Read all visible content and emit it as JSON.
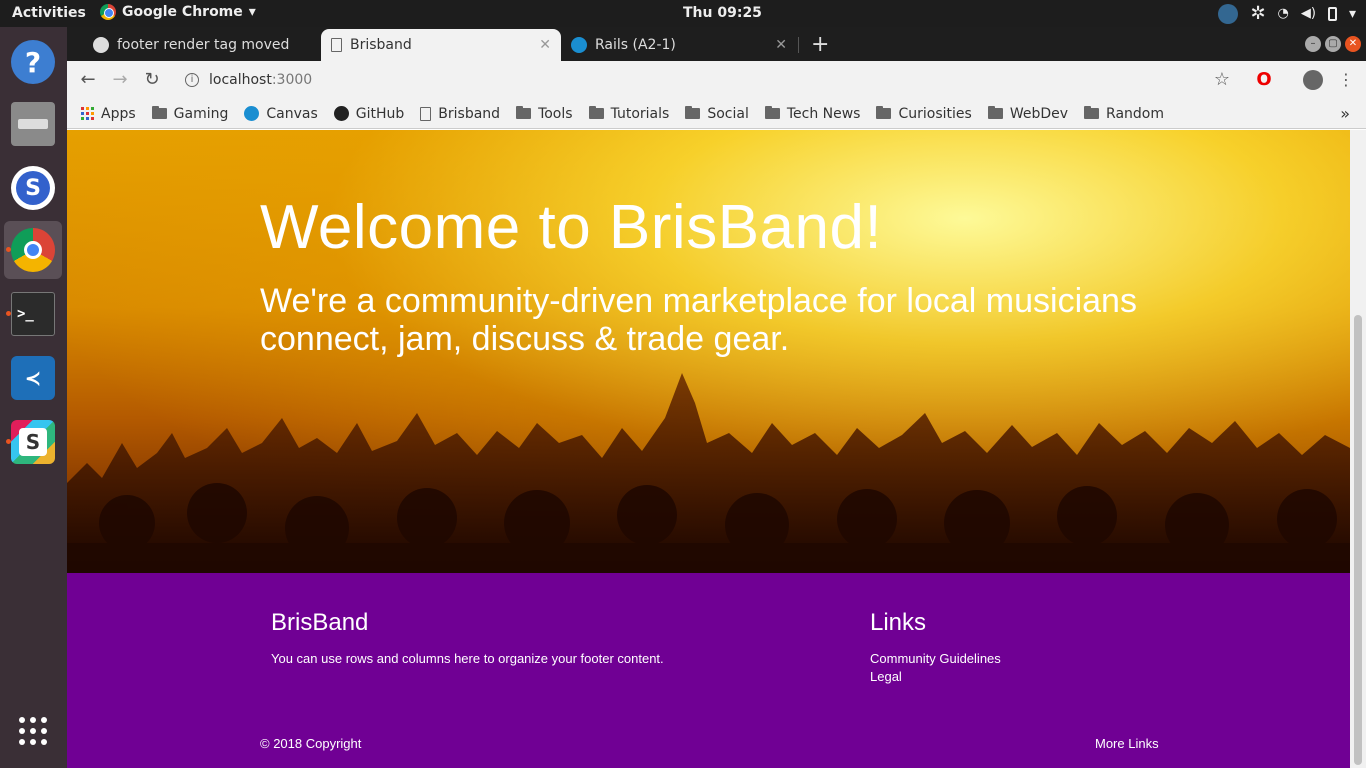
{
  "system": {
    "activities": "Activities",
    "app_name": "Google Chrome",
    "clock": "Thu 09:25"
  },
  "browser": {
    "tabs": [
      {
        "title": "footer render tag moved",
        "icon": "github-icon"
      },
      {
        "title": "Brisband",
        "icon": "page-icon"
      },
      {
        "title": "Rails (A2-1)",
        "icon": "canvas-icon"
      }
    ],
    "url_host": "localhost",
    "url_port": ":3000",
    "bookmarks": [
      "Apps",
      "Gaming",
      "Canvas",
      "GitHub",
      "Brisband",
      "Tools",
      "Tutorials",
      "Social",
      "Tech News",
      "Curiosities",
      "WebDev",
      "Random"
    ],
    "more": "»"
  },
  "hero": {
    "title": "Welcome to BrisBand!",
    "subtitle": "We're a community-driven marketplace for local musicians connect, jam, discuss & trade gear."
  },
  "footer": {
    "brand_title": "BrisBand",
    "brand_text": "You can use rows and columns here to organize your footer content.",
    "links_title": "Links",
    "links": [
      "Community Guidelines",
      "Legal"
    ],
    "copyright": "© 2018 Copyright",
    "more_links": "More Links"
  },
  "colors": {
    "footer_bg": "#700094",
    "hero_accent": "#f5d000",
    "dock_bg": "#3a2f36"
  }
}
